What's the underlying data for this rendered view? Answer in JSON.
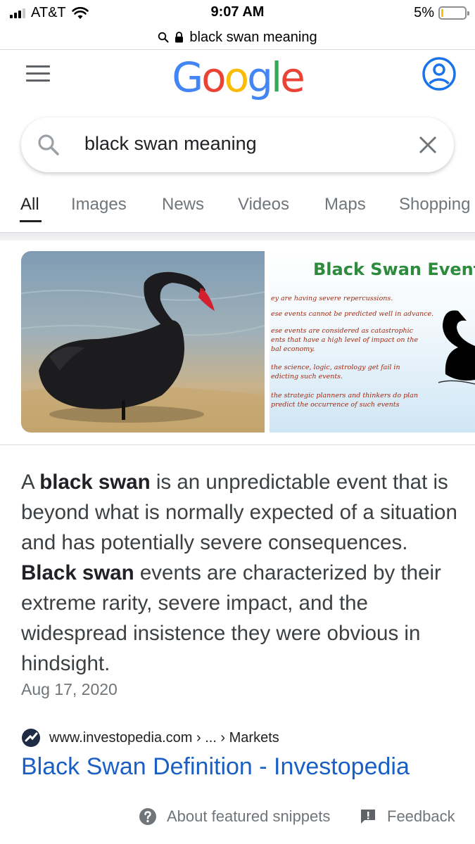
{
  "status_bar": {
    "carrier": "AT&T",
    "time": "9:07 AM",
    "battery_percent": "5%",
    "battery_level": 0.05
  },
  "url_bar": {
    "text": "black swan meaning"
  },
  "header": {
    "logo_text": "Google",
    "logo_colors": [
      "#4285F4",
      "#EA4335",
      "#FBBC05",
      "#4285F4",
      "#34A853",
      "#EA4335"
    ]
  },
  "search": {
    "query": "black swan meaning"
  },
  "tabs": [
    {
      "label": "All",
      "active": true
    },
    {
      "label": "Images"
    },
    {
      "label": "News"
    },
    {
      "label": "Videos"
    },
    {
      "label": "Maps"
    },
    {
      "label": "Shopping"
    }
  ],
  "images": {
    "second_title": "Black Swan Event",
    "second_lines": [
      "ey are having severe repercussions.",
      "ese events cannot be predicted well in advance.",
      "ese events are considered as catastrophic",
      "ents that have a high level of impact on the",
      "bal economy.",
      "the science, logic, astrology get fail in",
      "edicting such events.",
      "the strategic planners and thinkers do plan",
      "predict the occurrence of such events"
    ]
  },
  "snippet": {
    "p1": "A ",
    "b1": "black swan",
    "p2": " is an unpredictable event that is beyond what is normally expected of a situation and has potentially severe consequences. ",
    "b2": "Black swan",
    "p3": " events are characterized by their extreme rarity, severe impact, and the widespread insistence they were obvious in hindsight.",
    "date": "Aug 17, 2020"
  },
  "result": {
    "breadcrumb": "www.investopedia.com › ... › Markets",
    "title": "Black Swan Definition - Investopedia"
  },
  "footer": {
    "about": "About featured snippets",
    "feedback": "Feedback"
  },
  "icons": {
    "search": "search-icon",
    "lock": "lock-icon",
    "menu": "hamburger-menu-icon",
    "account": "account-icon",
    "clear": "close-icon",
    "help": "help-circle-icon",
    "feedback": "feedback-icon"
  }
}
